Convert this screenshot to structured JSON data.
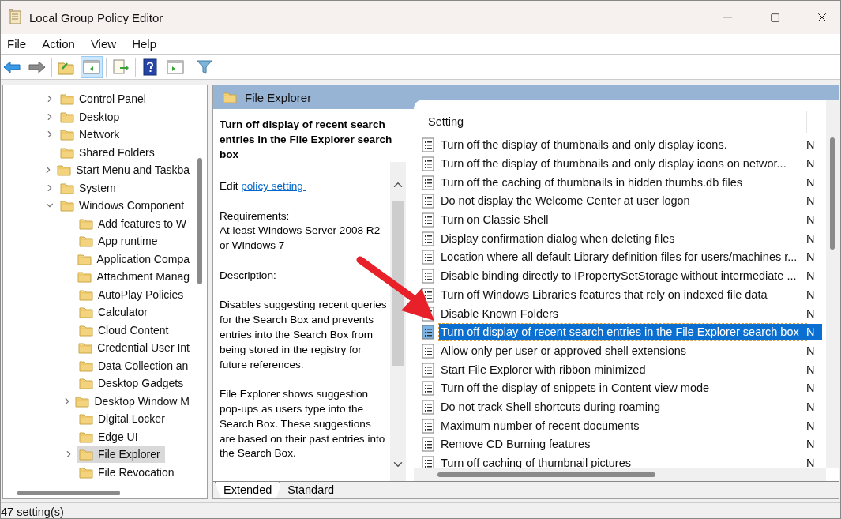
{
  "window": {
    "title": "Local Group Policy Editor"
  },
  "menu": [
    "File",
    "Action",
    "View",
    "Help"
  ],
  "toolbar": [
    {
      "pressed": false
    },
    {
      "pressed": false
    },
    {
      "pressed": false
    },
    {
      "pressed": true
    },
    {
      "pressed": false
    },
    {
      "pressed": false
    },
    {
      "pressed": false
    },
    {
      "pressed": false
    }
  ],
  "tree": [
    {
      "label": "Control Panel",
      "has_children": true,
      "expanded": false,
      "selected": false
    },
    {
      "label": "Desktop",
      "has_children": true,
      "expanded": false,
      "selected": false
    },
    {
      "label": "Network",
      "has_children": true,
      "expanded": false,
      "selected": false
    },
    {
      "label": "Shared Folders",
      "has_children": false,
      "selected": false
    },
    {
      "label": "Start Menu and Taskba",
      "has_children": true,
      "expanded": false,
      "selected": false
    },
    {
      "label": "System",
      "has_children": true,
      "expanded": false,
      "selected": false
    },
    {
      "label": "Windows Component",
      "has_children": true,
      "expanded": true,
      "selected": false,
      "children": [
        {
          "label": "Add features to W",
          "has_children": false,
          "selected": false
        },
        {
          "label": "App runtime",
          "has_children": false,
          "selected": false
        },
        {
          "label": "Application Compa",
          "has_children": false,
          "selected": false
        },
        {
          "label": "Attachment Manag",
          "has_children": false,
          "selected": false
        },
        {
          "label": "AutoPlay Policies",
          "has_children": false,
          "selected": false
        },
        {
          "label": "Calculator",
          "has_children": false,
          "selected": false
        },
        {
          "label": "Cloud Content",
          "has_children": false,
          "selected": false
        },
        {
          "label": "Credential User Int",
          "has_children": false,
          "selected": false
        },
        {
          "label": "Data Collection an",
          "has_children": false,
          "selected": false
        },
        {
          "label": "Desktop Gadgets",
          "has_children": false,
          "selected": false
        },
        {
          "label": "Desktop Window M",
          "has_children": true,
          "expanded": false,
          "selected": false
        },
        {
          "label": "Digital Locker",
          "has_children": false,
          "selected": false
        },
        {
          "label": "Edge UI",
          "has_children": false,
          "selected": false
        },
        {
          "label": "File Explorer",
          "has_children": true,
          "expanded": false,
          "selected": true
        },
        {
          "label": "File Revocation",
          "has_children": false,
          "selected": false
        }
      ]
    }
  ],
  "header": {
    "title": "File Explorer"
  },
  "description": {
    "title": "Turn off display of recent search entries in the File Explorer search box",
    "edit_prefix": "Edit",
    "edit_link": "policy setting ",
    "paragraphs": [
      "Requirements:\nAt least Windows Server 2008 R2\nor Windows 7",
      "Description:",
      "Disables suggesting recent queries for the Search Box and prevents entries into the Search Box from being stored in the registry for future references.",
      "File Explorer shows suggestion pop-ups as users type into the Search Box.  These suggestions are based on their past entries into the Search Box."
    ]
  },
  "table": {
    "columns": [
      "Setting"
    ],
    "rows": [
      {
        "setting": "Turn off the display of thumbnails and only display icons.",
        "column_2": "N",
        "selected": false
      },
      {
        "setting": "Turn off the display of thumbnails and only display icons on networ...",
        "column_2": "N",
        "selected": false
      },
      {
        "setting": "Turn off the caching of thumbnails in hidden thumbs.db files",
        "column_2": "N",
        "selected": false
      },
      {
        "setting": "Do not display the Welcome Center at user logon",
        "column_2": "N",
        "selected": false
      },
      {
        "setting": "Turn on Classic Shell",
        "column_2": "N",
        "selected": false
      },
      {
        "setting": "Display confirmation dialog when deleting files",
        "column_2": "N",
        "selected": false
      },
      {
        "setting": "Location where all default Library definition files for users/machines r...",
        "column_2": "N",
        "selected": false
      },
      {
        "setting": "Disable binding directly to IPropertySetStorage without intermediate ...",
        "column_2": "N",
        "selected": false
      },
      {
        "setting": "Turn off Windows Libraries features that rely on indexed file data",
        "column_2": "N",
        "selected": false
      },
      {
        "setting": "Disable Known Folders",
        "column_2": "N",
        "selected": false
      },
      {
        "setting": "Turn off display of recent search entries in the File Explorer search box",
        "column_2": "N",
        "selected": true
      },
      {
        "setting": "Allow only per user or approved shell extensions",
        "column_2": "N",
        "selected": false
      },
      {
        "setting": "Start File Explorer with ribbon minimized",
        "column_2": "N",
        "selected": false
      },
      {
        "setting": "Turn off the display of snippets in Content view mode",
        "column_2": "N",
        "selected": false
      },
      {
        "setting": "Do not track Shell shortcuts during roaming",
        "column_2": "N",
        "selected": false
      },
      {
        "setting": "Maximum number of recent documents",
        "column_2": "N",
        "selected": false
      },
      {
        "setting": "Remove CD Burning features",
        "column_2": "N",
        "selected": false
      },
      {
        "setting": "Turn off caching of thumbnail pictures",
        "column_2": "N",
        "selected": false
      }
    ]
  },
  "tabs": [
    {
      "label": "Extended",
      "selected": true
    },
    {
      "label": "Standard",
      "selected": false
    }
  ],
  "status_bar": {
    "text": "47 setting(s)"
  }
}
